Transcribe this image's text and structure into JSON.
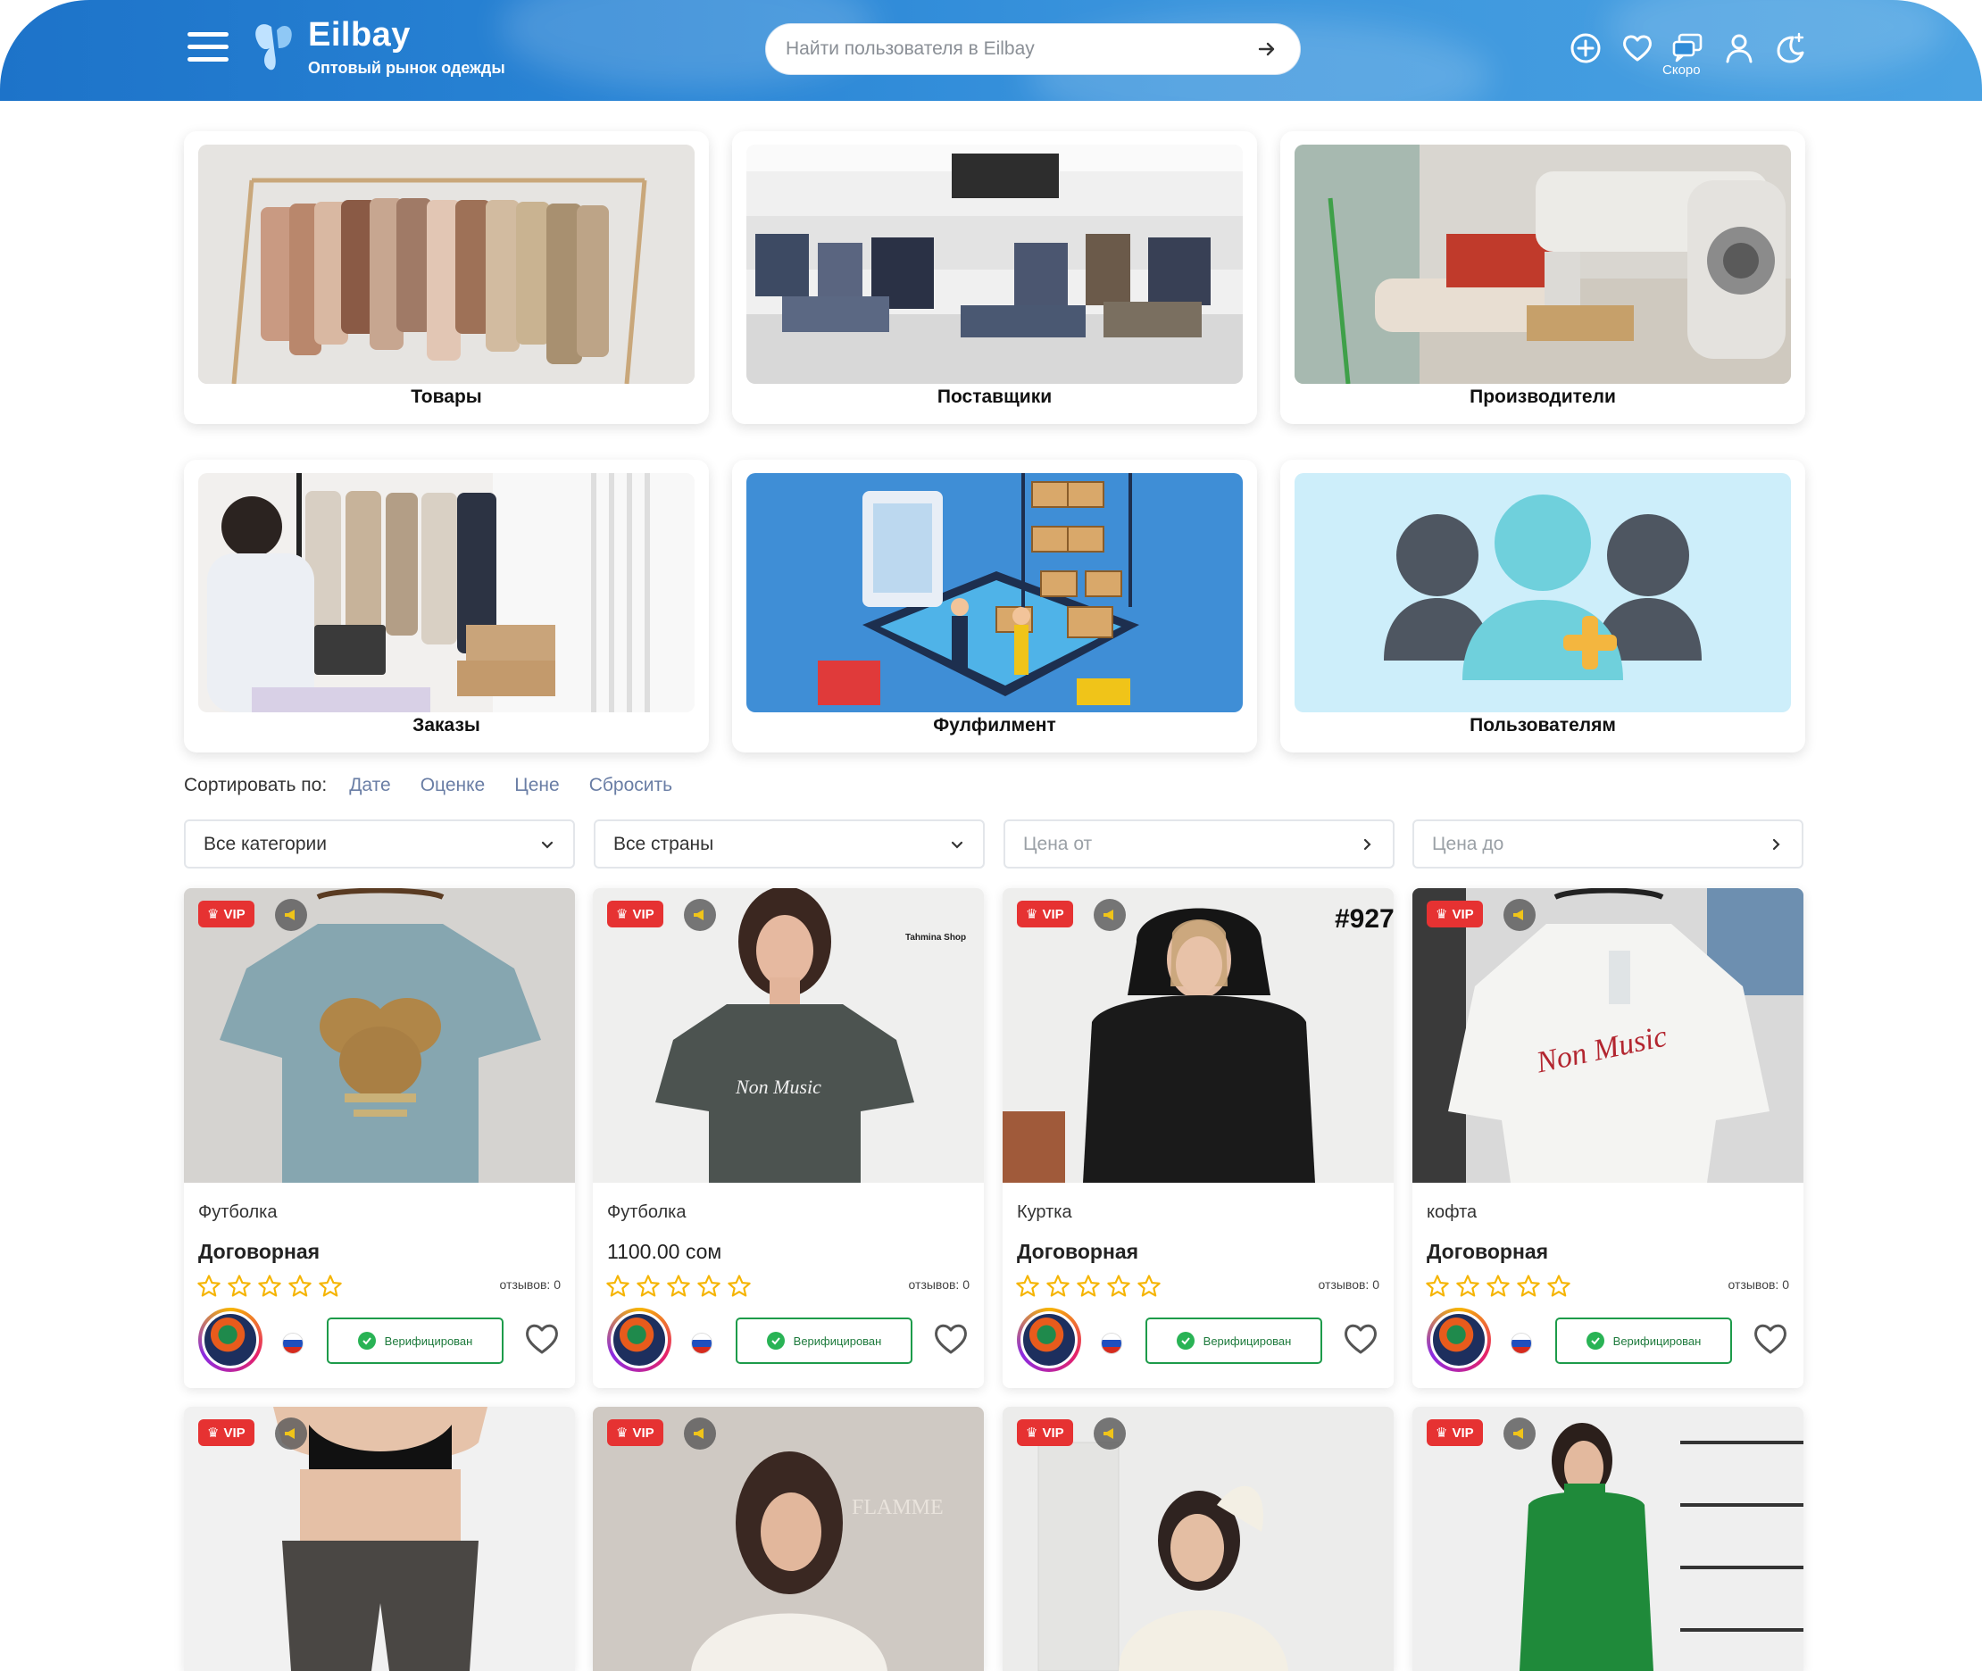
{
  "header": {
    "title": "Eilbay",
    "subtitle": "Оптовый рынок одежды",
    "search_placeholder": "Найти пользователя в Eilbay",
    "soon_label": "Скоро",
    "icons": [
      "plus-circle-icon",
      "heart-icon",
      "chat-icon",
      "user-icon",
      "moon-icon"
    ]
  },
  "categories": [
    {
      "label": "Товары"
    },
    {
      "label": "Поставщики"
    },
    {
      "label": "Производители"
    },
    {
      "label": "Заказы"
    },
    {
      "label": "Фулфилмент"
    },
    {
      "label": "Пользователям"
    }
  ],
  "sort": {
    "caption": "Сортировать по:",
    "options": [
      "Дате",
      "Оценке",
      "Цене",
      "Сбросить"
    ]
  },
  "filters": {
    "category": "Все категории",
    "country": "Все страны",
    "price_from": "Цена от",
    "price_to": "Цена до"
  },
  "products": [
    {
      "vip": "VIP",
      "category": "Футболка",
      "price": "Договорная",
      "reviews": "отзывов: 0",
      "verified": "Верифицирован"
    },
    {
      "vip": "VIP",
      "category": "Футболка",
      "price": "1100.00 сом",
      "reviews": "отзывов: 0",
      "verified": "Верифицирован"
    },
    {
      "vip": "VIP",
      "category": "Куртка",
      "price": "Договорная",
      "reviews": "отзывов: 0",
      "verified": "Верифицирован"
    },
    {
      "vip": "VIP",
      "category": "кофта",
      "price": "Договорная",
      "reviews": "отзывов: 0",
      "verified": "Верифицирован"
    },
    {
      "vip": "VIP"
    },
    {
      "vip": "VIP"
    },
    {
      "vip": "VIP"
    },
    {
      "vip": "VIP"
    }
  ],
  "photo_texts": {
    "p2_shop": "Tahmina Shop",
    "p2_shirt": "Non Music",
    "p3_tag": "#927",
    "p4_shirt": "Non Music",
    "p6_brand": "FLAMME"
  },
  "colors": {
    "header": "#2a86d6",
    "vip": "#e63232",
    "verified": "#1d9b4a",
    "star": "#f5b400",
    "link": "#6a7ea5"
  }
}
